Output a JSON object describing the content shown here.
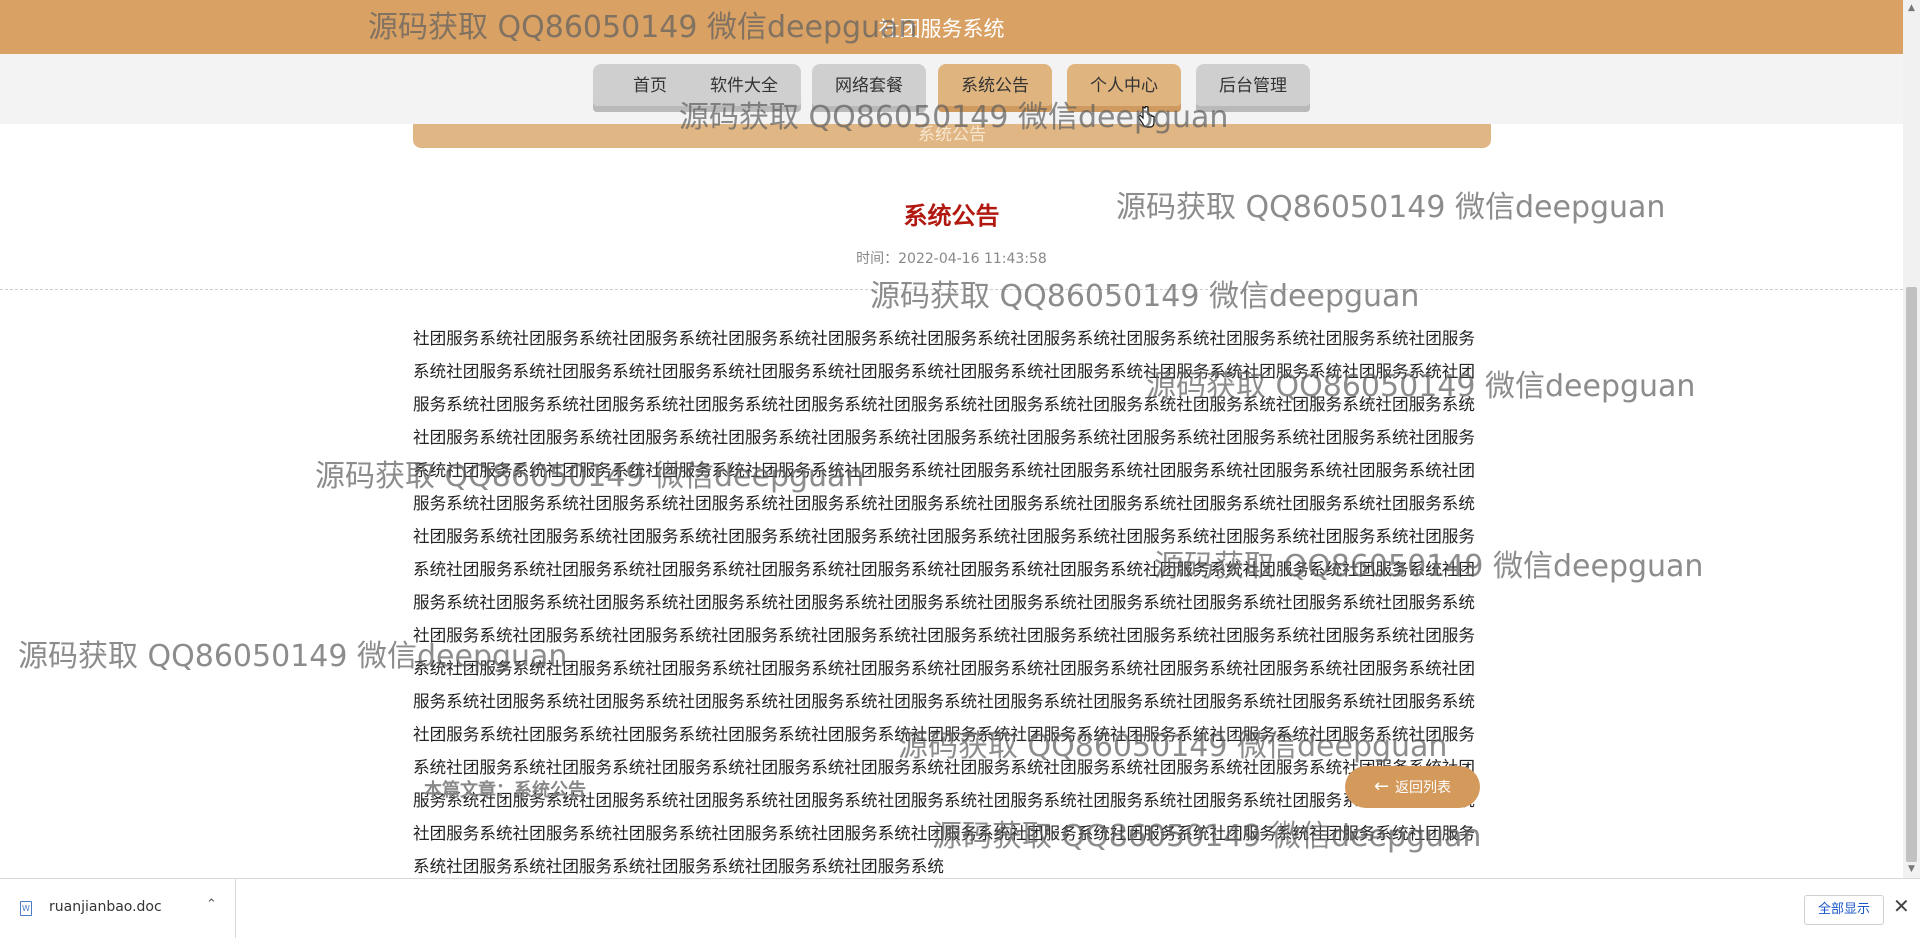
{
  "header": {
    "title": "社团服务系统"
  },
  "nav": {
    "items": [
      {
        "label": "首页"
      },
      {
        "label": "软件大全"
      },
      {
        "label": "网络套餐"
      },
      {
        "label": "系统公告"
      },
      {
        "label": "个人中心"
      },
      {
        "label": "后台管理"
      }
    ],
    "active_index": 3
  },
  "notice_bar": {
    "label": "系统公告"
  },
  "article": {
    "title": "系统公告",
    "time": "时间：2022-04-16 11:43:58",
    "body": "社团服务系统社团服务系统社团服务系统社团服务系统社团服务系统社团服务系统社团服务系统社团服务系统社团服务系统社团服务系统社团服务系统社团服务系统社团服务系统社团服务系统社团服务系统社团服务系统社团服务系统社团服务系统社团服务系统社团服务系统社团服务系统社团服务系统社团服务系统社团服务系统社团服务系统社团服务系统社团服务系统社团服务系统社团服务系统社团服务系统社团服务系统社团服务系统社团服务系统社团服务系统社团服务系统社团服务系统社团服务系统社团服务系统社团服务系统社团服务系统社团服务系统社团服务系统社团服务系统社团服务系统社团服务系统社团服务系统社团服务系统社团服务系统社团服务系统社团服务系统社团服务系统社团服务系统社团服务系统社团服务系统社团服务系统社团服务系统社团服务系统社团服务系统社团服务系统社团服务系统社团服务系统社团服务系统社团服务系统社团服务系统社团服务系统社团服务系统社团服务系统社团服务系统社团服务系统社团服务系统社团服务系统社团服务系统社团服务系统社团服务系统社团服务系统社团服务系统社团服务系统社团服务系统社团服务系统社团服务系统社团服务系统社团服务系统社团服务系统社团服务系统社团服务系统社团服务系统社团服务系统社团服务系统社团服务系统社团服务系统社团服务系统社团服务系统社团服务系统社团服务系统社团服务系统社团服务系统社团服务系统社团服务系统社团服务系统社团服务系统社团服务系统社团服务系统社团服务系统社团服务系统社团服务系统社团服务系统社团服务系统社团服务系统社团服务系统社团服务系统社团服务系统社团服务系统社团服务系统社团服务系统社团服务系统社团服务系统社团服务系统社团服务系统社团服务系统社团服务系统社团服务系统社团服务系统社团服务系统社团服务系统社团服务系统社团服务系统社团服务系统社团服务系统社团服务系统社团服务系统社团服务系统社团服务系统社团服务系统社团服务系统社团服务系统社团服务系统社团服务系统社团服务系统社团服务系统社团服务系统社团服务系统社团服务系统社团服务系统社团服务系统社团服务系统社团服务系统社团服务系统社团服务系统社团服务系统社团服务系统社团服务系统社团服务系统社团服务系统社团服务系统社团服务系统社团服务系统社团服务系统社团服务系统社团服务系统社团服务系统社团服务系统社团服务系统社团服务系统社团服务系统社团服务系统社团服务系统社团服务系统社团服务系统社团服务系统社团服务系统社团服务系统社团服务系统社团服务系统社团服务系统社团服务系统社团服务系统"
  },
  "footer": {
    "article_label": "本篇文章：系统公告",
    "back_button": "返回列表"
  },
  "watermark": {
    "text": "源码获取 QQ86050149 微信deepguan"
  },
  "download_bar": {
    "file_name": "ruanjianbao.doc",
    "show_all": "全部显示"
  },
  "colors": {
    "header": "#d9a164",
    "accent": "#d39a5c",
    "title_red": "#b1180f"
  },
  "icons": {
    "back": "arrow-left-icon",
    "file": "word-doc-icon",
    "expand": "chevron-up-icon",
    "close": "close-icon",
    "cursor": "hand-pointer-icon"
  }
}
